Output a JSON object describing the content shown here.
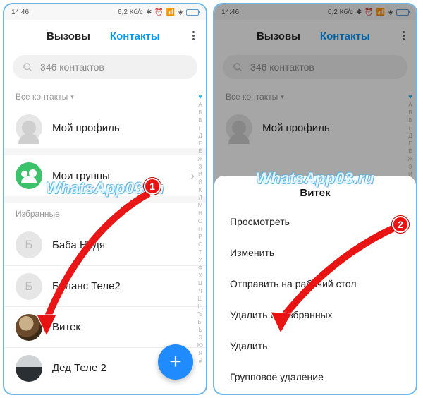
{
  "statusbar": {
    "time": "14:46",
    "net_left": "6,2 Кб/с",
    "net_right": "0,2 Кб/с"
  },
  "tabs": {
    "calls": "Вызовы",
    "contacts": "Контакты"
  },
  "search": {
    "placeholder": "346 контактов"
  },
  "filter": {
    "label": "Все контакты"
  },
  "profile": {
    "label": "Мой профиль"
  },
  "groups": {
    "label": "Мои группы"
  },
  "favorites": {
    "header": "Избранные",
    "items": [
      {
        "initial": "Б",
        "name": "Баба Надя"
      },
      {
        "initial": "Б",
        "name": "Баланс Теле2"
      },
      {
        "name": "Витек"
      },
      {
        "name": "Дед Теле 2"
      }
    ]
  },
  "az": "АБВГДЕЁЖЗИЙКЛМНОПРСТУФХЦЧШЩЪЫЬЭЮЯ#",
  "sheet": {
    "title": "Витек",
    "items": [
      "Просмотреть",
      "Изменить",
      "Отправить на рабочий стол",
      "Удалить из избранных",
      "Удалить",
      "Групповое удаление"
    ]
  },
  "badges": {
    "one": "1",
    "two": "2"
  },
  "watermark": "WhatsApp03.ru"
}
